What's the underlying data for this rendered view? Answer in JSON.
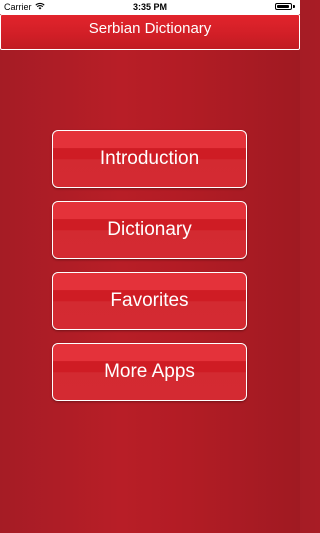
{
  "status_bar": {
    "carrier": "Carrier",
    "time": "3:35 PM",
    "battery_level": 0.95,
    "wifi_icon": "wifi-icon",
    "battery_icon": "battery-icon"
  },
  "nav": {
    "title": "Serbian Dictionary"
  },
  "menu": {
    "items": [
      {
        "label": "Introduction"
      },
      {
        "label": "Dictionary"
      },
      {
        "label": "Favorites"
      },
      {
        "label": "More Apps"
      }
    ]
  },
  "colors": {
    "background": "#b11c25",
    "nav_bar": "#d21f27",
    "button": "#d42a32",
    "text": "#ffffff"
  }
}
